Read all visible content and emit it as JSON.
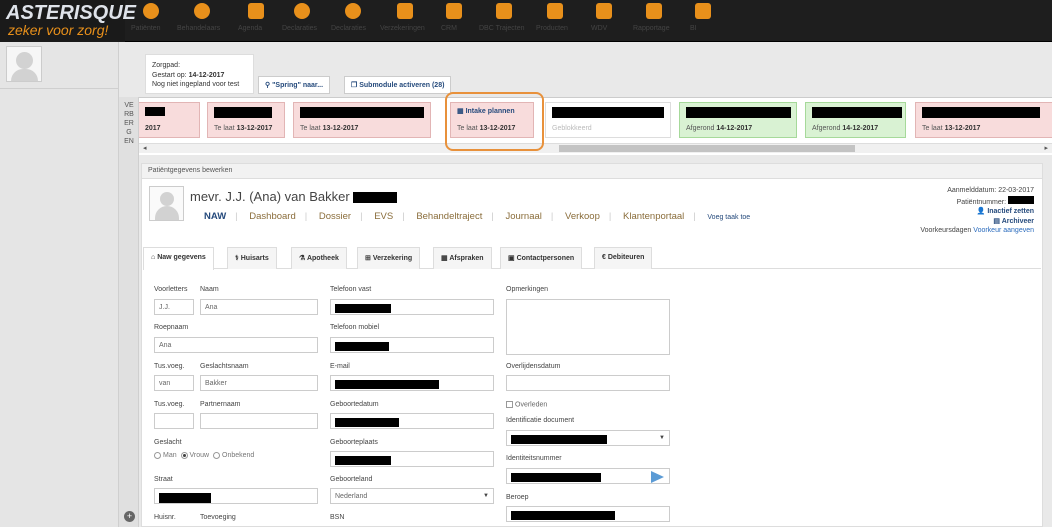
{
  "logo": {
    "top": "ASTERISQUE",
    "bottom": "zeker voor zorg!"
  },
  "nav": [
    {
      "label": "Patiënten",
      "icon": "patient-icon"
    },
    {
      "label": "Behandelaars",
      "icon": "behandelaars-icon"
    },
    {
      "label": "Agenda",
      "icon": "calendar-icon"
    },
    {
      "label": "Declaraties",
      "icon": "euro-icon"
    },
    {
      "label": "Declaraties",
      "icon": "euro-icon"
    },
    {
      "label": "Verzekeringen",
      "icon": "inbox-icon"
    },
    {
      "label": "CRM",
      "icon": "book-icon"
    },
    {
      "label": "DBC Trajecten",
      "icon": "sitemap-icon"
    },
    {
      "label": "Producten",
      "icon": "tag-icon"
    },
    {
      "label": "WDV",
      "icon": "upload-icon"
    },
    {
      "label": "Rapportage",
      "icon": "bar-chart-icon"
    },
    {
      "label": "BI",
      "icon": "bar-chart-icon"
    }
  ],
  "sidebar": {
    "toggle_label": "VERBERGEN",
    "add_icon": "plus-circle-icon"
  },
  "zorgpad": {
    "title": "Zorgpad:",
    "started_label": "Gestart op:",
    "started_date": "14-12-2017",
    "status": "Nog niet ingepland voor test",
    "spring_button": "\"Spring\" naar...",
    "submodule_button": "Submodule activeren (28)"
  },
  "timeline": [
    {
      "title": "",
      "prefix": "",
      "date": "2017",
      "color": "red"
    },
    {
      "title": "",
      "prefix": "Te laat",
      "date": "13-12-2017",
      "color": "red"
    },
    {
      "title": "",
      "prefix": "Te laat",
      "date": "13-12-2017",
      "color": "red"
    },
    {
      "title": "Intake plannen",
      "prefix": "Te laat",
      "date": "13-12-2017",
      "color": "red"
    },
    {
      "title": "",
      "prefix": "Geblokkeerd",
      "date": "",
      "color": "white"
    },
    {
      "title": "",
      "prefix": "Afgerond",
      "date": "14-12-2017",
      "color": "green"
    },
    {
      "title": "",
      "prefix": "Afgerond",
      "date": "14-12-2017",
      "color": "green"
    },
    {
      "title": "",
      "prefix": "Te laat",
      "date": "13-12-2017",
      "color": "red"
    }
  ],
  "panel": {
    "header": "Patiëntgegevens bewerken",
    "patient_name": "mevr. J.J. (Ana) van Bakker",
    "tabs": [
      "NAW",
      "Dashboard",
      "Dossier",
      "EVS",
      "Behandeltraject",
      "Journaal",
      "Verkoop",
      "Klantenportaal"
    ],
    "extra_action": "Voeg taak toe",
    "right": {
      "aanmelddatum": "Aanmelddatum: 22-03-2017",
      "patientnummer": "Patiëntnummer:",
      "inactief": "Inactief zetten",
      "archiveer": "Archiveer",
      "voorkeursdagen": "Voorkeursdagen",
      "voorkeur_link": "Voorkeur aangeven"
    },
    "subtabs": [
      "Naw gegevens",
      "Huisarts",
      "Apotheek",
      "Verzekering",
      "Afspraken",
      "Contactpersonen",
      "Debiteuren"
    ]
  },
  "form": {
    "voorletters_label": "Voorletters",
    "naam_label": "Naam",
    "voorletters_value": "J.J.",
    "naam_value": "Ana",
    "roepnaam_label": "Roepnaam",
    "roepnaam_value": "Ana",
    "tusvoeg_label": "Tus.voeg.",
    "geslachtsnaam_label": "Geslachtsnaam",
    "tusvoeg_value": "van",
    "geslachtsnaam_value": "Bakker",
    "tusvoeg2_label": "Tus.voeg.",
    "partnernaam_label": "Partnernaam",
    "geslacht_label": "Geslacht",
    "geslacht_options": [
      "Man",
      "Vrouw",
      "Onbekend"
    ],
    "straat_label": "Straat",
    "huisnr_label": "Huisnr.",
    "toevoeging_label": "Toevoeging",
    "telefoon_vast_label": "Telefoon vast",
    "telefoon_mobiel_label": "Telefoon mobiel",
    "email_label": "E-mail",
    "geboortedatum_label": "Geboortedatum",
    "geboorteplaats_label": "Geboorteplaats",
    "geboorteland_label": "Geboorteland",
    "geboorteland_value": "Nederland",
    "bsn_label": "BSN",
    "opmerkingen_label": "Opmerkingen",
    "overlijdensdatum_label": "Overlijdensdatum",
    "overleden_label": "Overleden",
    "identificatie_label": "Identificatie document",
    "identiteitsnummer_label": "Identiteitsnummer",
    "beroep_label": "Beroep"
  },
  "colors": {
    "accent": "#e8901b",
    "link": "#254a7c",
    "highlight": "#e8913b"
  }
}
